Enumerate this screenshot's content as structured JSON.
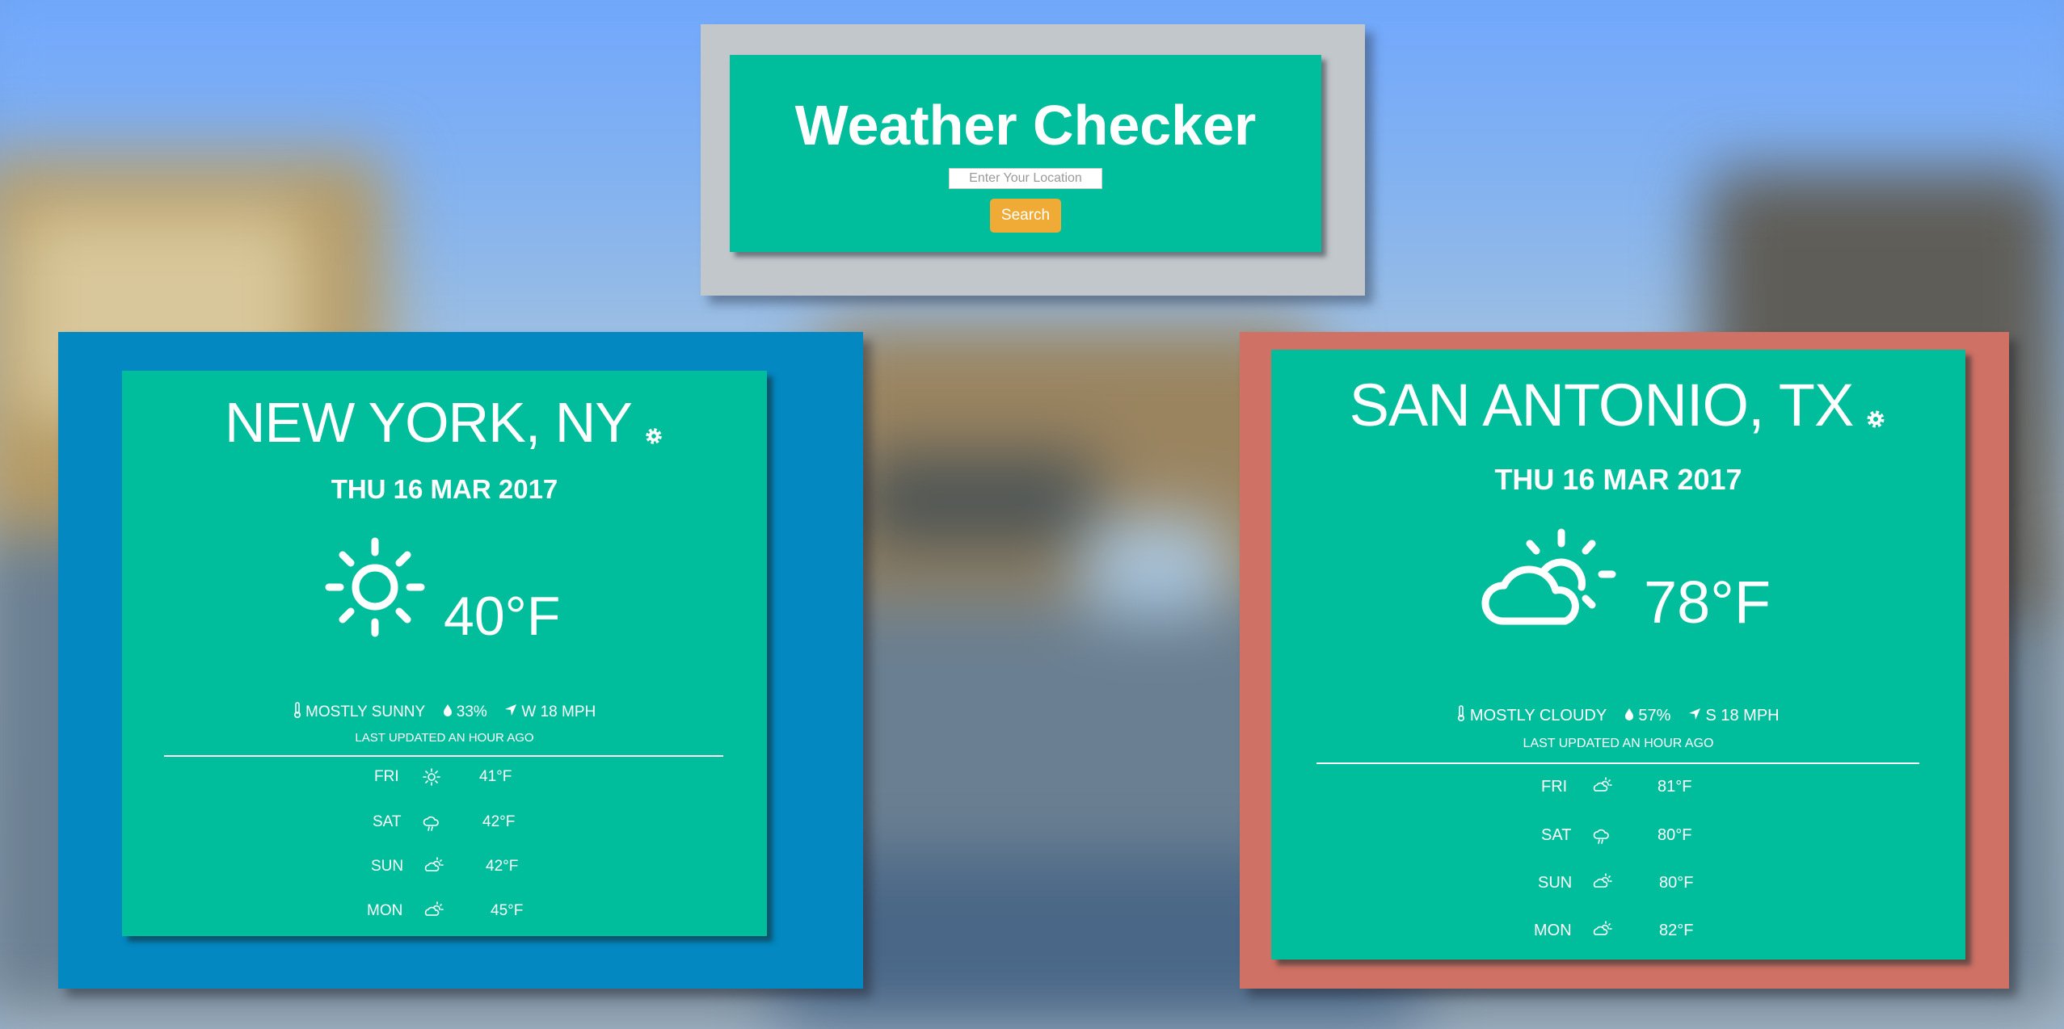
{
  "app": {
    "title": "Weather Checker",
    "search_placeholder": "Enter Your Location",
    "search_button": "Search",
    "colors": {
      "card": "#00be9c",
      "button": "#f0ab37",
      "header_frame": "#c2c7cc"
    }
  },
  "cities": [
    {
      "name": "NEW YORK, NY",
      "date": "THU 16 MAR 2017",
      "icon": "sun-icon",
      "temp": "40°F",
      "condition": "MOSTLY SUNNY",
      "humidity": "33%",
      "wind": "W 18 MPH",
      "updated": "LAST UPDATED AN HOUR AGO",
      "frame_color": "#0388c2",
      "forecast": [
        {
          "day": "FRI",
          "icon": "sun-icon",
          "temp": "41°F"
        },
        {
          "day": "SAT",
          "icon": "rain-cloud-icon",
          "temp": "42°F"
        },
        {
          "day": "SUN",
          "icon": "partly-cloudy-icon",
          "temp": "42°F"
        },
        {
          "day": "MON",
          "icon": "partly-cloudy-icon",
          "temp": "45°F"
        }
      ]
    },
    {
      "name": "SAN ANTONIO, TX",
      "date": "THU 16 MAR 2017",
      "icon": "partly-cloudy-icon",
      "temp": "78°F",
      "condition": "MOSTLY CLOUDY",
      "humidity": "57%",
      "wind": "S 18 MPH",
      "updated": "LAST UPDATED AN HOUR AGO",
      "frame_color": "#cf7165",
      "forecast": [
        {
          "day": "FRI",
          "icon": "partly-cloudy-icon",
          "temp": "81°F"
        },
        {
          "day": "SAT",
          "icon": "rain-cloud-icon",
          "temp": "80°F"
        },
        {
          "day": "SUN",
          "icon": "partly-cloudy-icon",
          "temp": "80°F"
        },
        {
          "day": "MON",
          "icon": "partly-cloudy-icon",
          "temp": "82°F"
        }
      ]
    }
  ]
}
